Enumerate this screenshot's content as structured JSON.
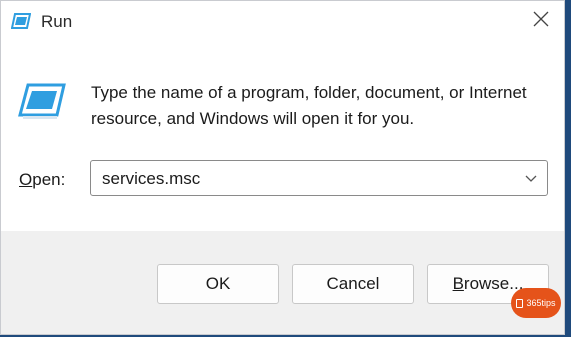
{
  "window": {
    "title": "Run"
  },
  "description": "Type the name of a program, folder, document, or Internet resource, and Windows will open it for you.",
  "open_label_prefix": "O",
  "open_label_rest": "pen:",
  "open_value": "services.msc",
  "buttons": {
    "ok": "OK",
    "cancel": "Cancel",
    "browse_prefix": "B",
    "browse_rest": "rowse..."
  },
  "watermark": "365tips",
  "icons": {
    "title": "run-icon",
    "close": "close-icon",
    "dropdown": "chevron-down-icon"
  },
  "colors": {
    "footer": "#f0f0f0",
    "badge": "#e5531a",
    "icon_blue": "#2f9ee0"
  }
}
